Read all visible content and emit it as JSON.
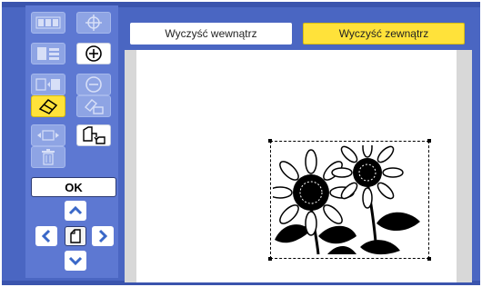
{
  "tabs": {
    "clear_inside": "Wyczyść wewnątrz",
    "clear_outside": "Wyczyść zewnątrz"
  },
  "sidebar": {
    "ok_label": "OK",
    "tools": [
      {
        "name": "multi-up-icon",
        "state": "disabled"
      },
      {
        "name": "crosshair-icon",
        "state": "disabled"
      },
      {
        "name": "layout-icon",
        "state": "disabled"
      },
      {
        "name": "zoom-in-icon",
        "state": "active"
      },
      {
        "name": "compare-icon",
        "state": "disabled"
      },
      {
        "name": "zoom-out-icon",
        "state": "disabled"
      },
      {
        "name": "eraser-icon",
        "state": "selected"
      },
      {
        "name": "erase-edit-icon",
        "state": "disabled"
      },
      {
        "name": "move-icon",
        "state": "disabled"
      },
      {
        "name": "rotate-icon",
        "state": "active"
      },
      {
        "name": "trash-icon",
        "state": "disabled"
      }
    ]
  },
  "colors": {
    "frame": "#4a66c2",
    "sidebar": "#5d78d2",
    "accent_yellow": "#ffe23a",
    "arrow_blue": "#3a68c8"
  }
}
